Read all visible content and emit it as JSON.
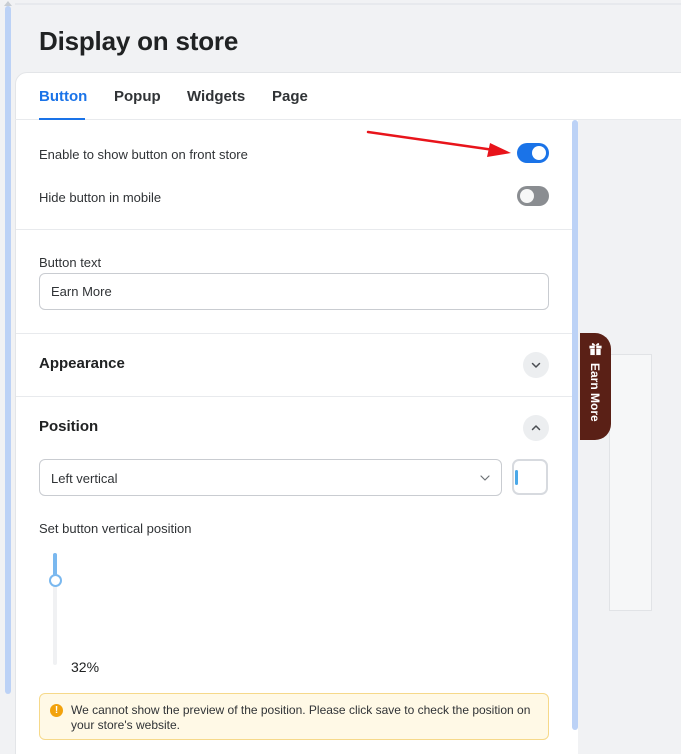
{
  "page": {
    "title": "Display on store"
  },
  "tabs": [
    {
      "label": "Button",
      "active": true
    },
    {
      "label": "Popup",
      "active": false
    },
    {
      "label": "Widgets",
      "active": false
    },
    {
      "label": "Page",
      "active": false
    }
  ],
  "settings": {
    "show_button_label": "Enable to show button on front store",
    "show_button_on": true,
    "hide_mobile_label": "Hide button in mobile",
    "hide_mobile_on": false
  },
  "button_text": {
    "label": "Button text",
    "value": "Earn More"
  },
  "appearance": {
    "title": "Appearance",
    "expanded": false,
    "icon": "chevron-down-icon"
  },
  "position": {
    "title": "Position",
    "expanded": true,
    "icon": "chevron-up-icon",
    "select_value": "Left vertical",
    "slider_label": "Set button vertical position",
    "slider_value": "32%",
    "slider_fraction": 0.32
  },
  "notice": {
    "icon": "warning-icon",
    "text": "We cannot show the preview of the position. Please click save to check the position on your store's website."
  },
  "preview": {
    "button_label": "Earn More",
    "button_icon": "gift-icon",
    "button_color": "#5a2016"
  },
  "colors": {
    "accent": "#1a73e8",
    "annotation_arrow": "#e8141b"
  }
}
